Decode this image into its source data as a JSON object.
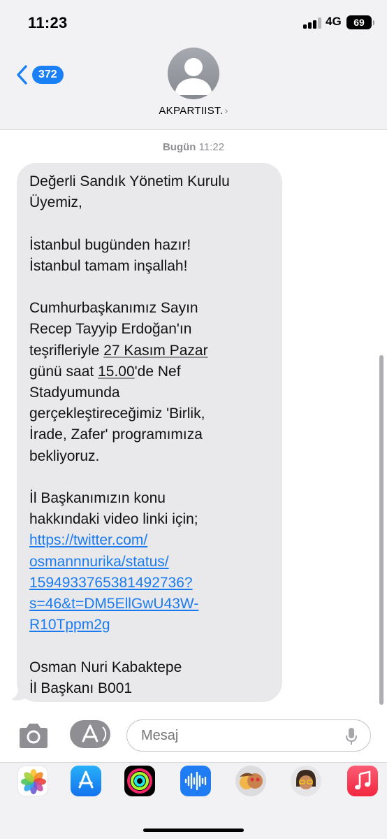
{
  "status_bar": {
    "time": "11:23",
    "network": "4G",
    "battery": "69"
  },
  "header": {
    "back_count": "372",
    "contact_name": "AKPARTIIST."
  },
  "conversation": {
    "timestamp_day": "Bugün",
    "timestamp_time": "11:22",
    "message": {
      "p1": "Değerli Sandık Yönetim Kurulu\nÜyemiz,",
      "p2": "İstanbul bugünden hazır!\nİstanbul tamam inşallah!",
      "p3_a": "Cumhurbaşkanımız Sayın\nRecep Tayyip Erdoğan'ın\nteşrifleriyle ",
      "p3_date": "27 Kasım Pazar",
      "p3_b": "\ngünü saat ",
      "p3_time": "15.00",
      "p3_c": "'de Nef\nStadyumunda\ngerçekleştireceğimiz 'Birlik,\nİrade, Zafer' programımıza\nbekliyoruz.",
      "p4": "İl Başkanımızın konu\nhakkındaki video linki için;",
      "link": "https://twitter.com/\nosmannnurika/status/\n1594933765381492736?\ns=46&t=DM5EllGwU43W-\nR10Tppm2g",
      "p5": "Osman Nuri Kabaktepe\nİl Başkanı B001"
    }
  },
  "input": {
    "placeholder": "Mesaj"
  },
  "app_drawer": {
    "apps": [
      "photos-icon",
      "app-store-icon",
      "activity-icon",
      "audio-message-icon",
      "memoji-stickers-icon",
      "memoji-icon",
      "music-icon"
    ]
  },
  "colors": {
    "accent": "#1a80f6",
    "bubble": "#e9e9eb",
    "header_bg": "#f2f2f4"
  }
}
